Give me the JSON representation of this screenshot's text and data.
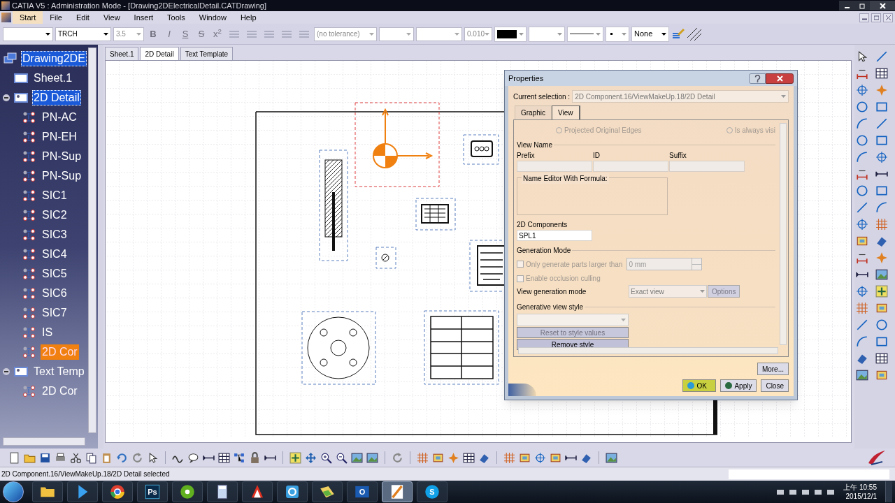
{
  "window": {
    "title": "CATIA V5 : Administration Mode - [Drawing2DElectricalDetail.CATDrawing]"
  },
  "menu": [
    {
      "label": "Start",
      "selected": true
    },
    {
      "label": "File",
      "selected": false
    },
    {
      "label": "Edit",
      "selected": false
    },
    {
      "label": "View",
      "selected": false
    },
    {
      "label": "Insert",
      "selected": false
    },
    {
      "label": "Tools",
      "selected": false
    },
    {
      "label": "Window",
      "selected": false
    },
    {
      "label": "Help",
      "selected": false
    }
  ],
  "format_toolbar": {
    "font": "TRCH",
    "size": "3.5",
    "text_styles": [
      "B",
      "I",
      "S",
      "S",
      "x$^{2}$"
    ],
    "tolerance": "(no tolerance)",
    "precision": "0.010",
    "fill": "None"
  },
  "tree": {
    "items": [
      {
        "label": "Drawing2DE",
        "kind": "drawing",
        "highlighted": true,
        "selected": false,
        "children": [
          {
            "label": "Sheet.1",
            "kind": "sheet",
            "highlighted": false,
            "selected": false
          },
          {
            "label": "2D Detail",
            "kind": "view",
            "highlighted": true,
            "selected": false,
            "expanded": true,
            "children": [
              {
                "label": "PN-AC",
                "kind": "component",
                "highlighted": false,
                "selected": false
              },
              {
                "label": "PN-EH",
                "kind": "component",
                "highlighted": false,
                "selected": false
              },
              {
                "label": "PN-Sup",
                "kind": "component",
                "highlighted": false,
                "selected": false
              },
              {
                "label": "PN-Sup",
                "kind": "component",
                "highlighted": false,
                "selected": false
              },
              {
                "label": "SIC1",
                "kind": "component",
                "highlighted": false,
                "selected": false
              },
              {
                "label": "SIC2",
                "kind": "component",
                "highlighted": false,
                "selected": false
              },
              {
                "label": "SIC3",
                "kind": "component",
                "highlighted": false,
                "selected": false
              },
              {
                "label": "SIC4",
                "kind": "component",
                "highlighted": false,
                "selected": false
              },
              {
                "label": "SIC5",
                "kind": "component",
                "highlighted": false,
                "selected": false
              },
              {
                "label": "SIC6",
                "kind": "component",
                "highlighted": false,
                "selected": false
              },
              {
                "label": "SIC7",
                "kind": "component",
                "highlighted": false,
                "selected": false
              },
              {
                "label": "IS",
                "kind": "component",
                "highlighted": false,
                "selected": false
              },
              {
                "label": "2D Cor",
                "kind": "component",
                "highlighted": false,
                "selected": true
              }
            ]
          },
          {
            "label": "Text Temp",
            "kind": "view",
            "highlighted": false,
            "selected": false,
            "expanded": true,
            "children": [
              {
                "label": "2D Cor",
                "kind": "component",
                "highlighted": false,
                "selected": false
              }
            ]
          }
        ]
      }
    ]
  },
  "sheet_tabs": [
    {
      "label": "Sheet.1",
      "selected": false
    },
    {
      "label": "2D Detail",
      "selected": true
    },
    {
      "label": "Text Template",
      "selected": false
    }
  ],
  "dialog": {
    "title": "Properties",
    "current_selection_label": "Current selection :",
    "current_selection": "2D Component.16/ViewMakeUp.18/2D Detail",
    "tabs": [
      {
        "label": "Graphic",
        "selected": false
      },
      {
        "label": "View",
        "selected": true
      }
    ],
    "radios": [
      {
        "label": "Projected Original Edges",
        "checked": false,
        "disabled": true
      },
      {
        "label": "Is always visi",
        "checked": false,
        "disabled": true
      }
    ],
    "view_name": {
      "title": "View Name",
      "fields": [
        "Prefix",
        "ID",
        "Suffix"
      ],
      "formula_group": "Name Editor With Formula:"
    },
    "components": {
      "label": "2D Components",
      "value": "SPL1"
    },
    "generation_mode": {
      "title": "Generation Mode",
      "checkboxes": [
        {
          "label": "Only generate parts larger than",
          "checked": false,
          "disabled": true
        },
        {
          "label": "Enable occlusion culling",
          "checked": false,
          "disabled": true
        }
      ],
      "size_value": "0 mm",
      "mode_label": "View generation mode",
      "mode_value": "Exact view",
      "options_button": {
        "label": "Options",
        "disabled": true
      }
    },
    "style": {
      "title": "Generative view style",
      "buttons": [
        {
          "label": "Reset to style values",
          "disabled": true
        },
        {
          "label": "Remove style",
          "disabled": false
        }
      ]
    },
    "more_button": "More...",
    "buttons": [
      {
        "label": "OK",
        "kind": "ok"
      },
      {
        "label": "Apply",
        "kind": "apply"
      },
      {
        "label": "Close",
        "kind": "close"
      }
    ]
  },
  "status_bar": "2D Component.16/ViewMakeUp.18/2D Detail selected",
  "taskbar": {
    "apps": [
      {
        "kind": "folder",
        "active": false
      },
      {
        "kind": "player",
        "active": false
      },
      {
        "kind": "browser",
        "active": false
      },
      {
        "kind": "ps",
        "label": "Ps",
        "active": false
      },
      {
        "kind": "disc",
        "active": false
      },
      {
        "kind": "calculator",
        "active": false
      },
      {
        "kind": "reader",
        "active": false
      },
      {
        "kind": "cloud",
        "active": false
      },
      {
        "kind": "files",
        "active": false
      },
      {
        "kind": "mail",
        "label": "O",
        "active": false
      },
      {
        "kind": "catia",
        "active": true
      },
      {
        "kind": "chat",
        "label": "S",
        "active": false
      }
    ],
    "time": "上午 10:55",
    "date": "2015/12/1"
  }
}
